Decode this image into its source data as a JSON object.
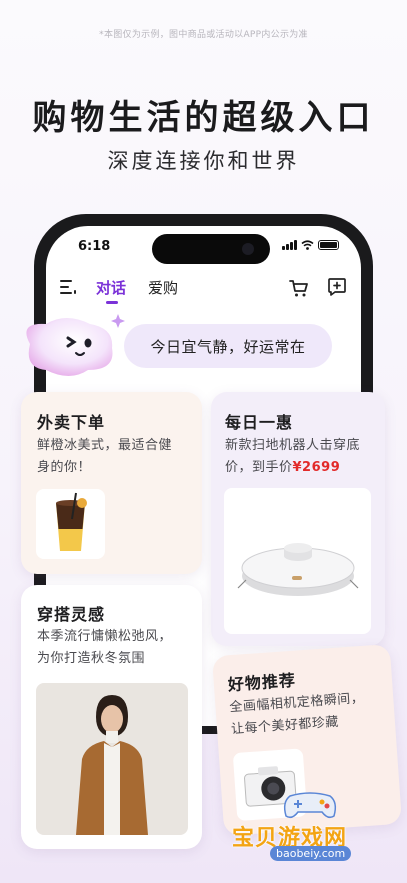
{
  "disclaimer": "*本图仅为示例，图中商品或活动以APP内公示为准",
  "headline": "购物生活的超级入口",
  "subhead": "深度连接你和世界",
  "status": {
    "time": "6:18"
  },
  "appbar": {
    "tabs": [
      {
        "label": "对话",
        "active": true
      },
      {
        "label": "爱购",
        "active": false
      }
    ]
  },
  "greeting": "今日宜气静，好运常在",
  "cards": {
    "food": {
      "title": "外卖下单",
      "text_line1": "鲜橙冰美式，最适合健",
      "text_line2": "身的你！"
    },
    "deal": {
      "title": "每日一惠",
      "text_line1": "新款扫地机器人击穿底",
      "text_line2_prefix": "价，到手价",
      "price": "¥2699"
    },
    "outfit": {
      "title": "穿搭灵感",
      "text_line1": "本季流行慵懒松弛风，",
      "text_line2": "为你打造秋冬氛围"
    },
    "rec": {
      "title": "好物推荐",
      "text_line1": "全画幅相机定格瞬间，",
      "text_line2": "让每个美好都珍藏"
    }
  },
  "watermark": {
    "text": "宝贝游戏网",
    "url": "baobeiy.com"
  },
  "colors": {
    "accent": "#7b32d8",
    "price": "#e22a2a"
  }
}
